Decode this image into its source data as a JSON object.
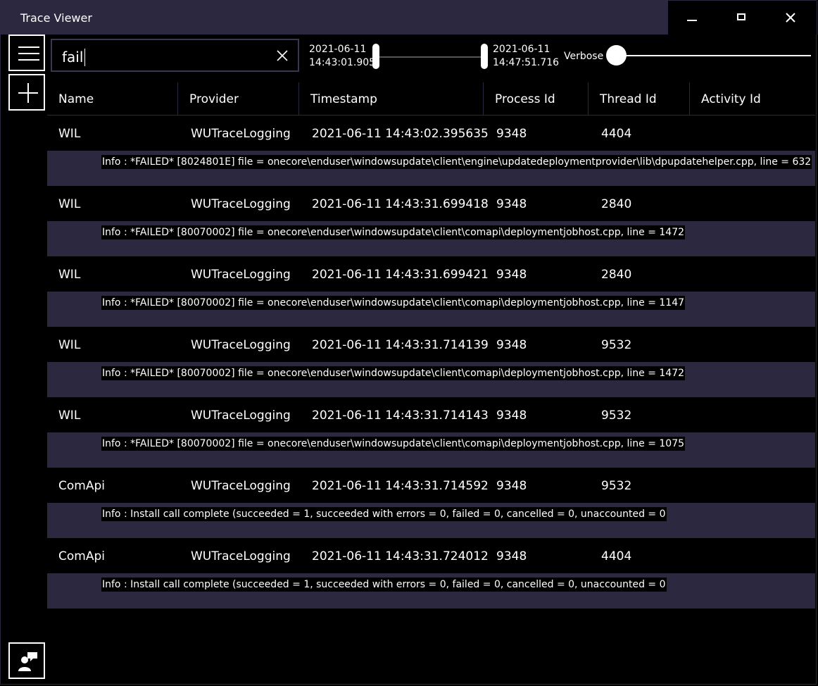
{
  "window": {
    "title": "Trace Viewer"
  },
  "search": {
    "value": "fail"
  },
  "time_range": {
    "start_date": "2021-06-11",
    "start_time": "14:43:01.905",
    "end_date": "2021-06-11",
    "end_time": "14:47:51.716"
  },
  "verbosity": {
    "label": "Verbose"
  },
  "table": {
    "columns": [
      "Name",
      "Provider",
      "Timestamp",
      "Process Id",
      "Thread Id",
      "Activity Id"
    ],
    "rows": [
      {
        "name": "WIL",
        "provider": "WUTraceLogging",
        "timestamp": "2021-06-11 14:43:02.395635",
        "process_id": "9348",
        "thread_id": "4404",
        "activity_id": "",
        "message": "Info : *FAILED* [8024801E] file = onecore\\enduser\\windowsupdate\\client\\engine\\updatedeploymentprovider\\lib\\dpupdatehelper.cpp, line = 632"
      },
      {
        "name": "WIL",
        "provider": "WUTraceLogging",
        "timestamp": "2021-06-11 14:43:31.699418",
        "process_id": "9348",
        "thread_id": "2840",
        "activity_id": "",
        "message": "Info : *FAILED* [80070002] file = onecore\\enduser\\windowsupdate\\client\\comapi\\deploymentjobhost.cpp, line = 1472"
      },
      {
        "name": "WIL",
        "provider": "WUTraceLogging",
        "timestamp": "2021-06-11 14:43:31.699421",
        "process_id": "9348",
        "thread_id": "2840",
        "activity_id": "",
        "message": "Info : *FAILED* [80070002] file = onecore\\enduser\\windowsupdate\\client\\comapi\\deploymentjobhost.cpp, line = 1147"
      },
      {
        "name": "WIL",
        "provider": "WUTraceLogging",
        "timestamp": "2021-06-11 14:43:31.714139",
        "process_id": "9348",
        "thread_id": "9532",
        "activity_id": "",
        "message": "Info : *FAILED* [80070002] file = onecore\\enduser\\windowsupdate\\client\\comapi\\deploymentjobhost.cpp, line = 1472"
      },
      {
        "name": "WIL",
        "provider": "WUTraceLogging",
        "timestamp": "2021-06-11 14:43:31.714143",
        "process_id": "9348",
        "thread_id": "9532",
        "activity_id": "",
        "message": "Info : *FAILED* [80070002] file = onecore\\enduser\\windowsupdate\\client\\comapi\\deploymentjobhost.cpp, line = 1075"
      },
      {
        "name": "ComApi",
        "provider": "WUTraceLogging",
        "timestamp": "2021-06-11 14:43:31.714592",
        "process_id": "9348",
        "thread_id": "9532",
        "activity_id": "",
        "message": "Info : Install call complete (succeeded = 1, succeeded with errors = 0, failed = 0, cancelled = 0, unaccounted = 0"
      },
      {
        "name": "ComApi",
        "provider": "WUTraceLogging",
        "timestamp": "2021-06-11 14:43:31.724012",
        "process_id": "9348",
        "thread_id": "4404",
        "activity_id": "",
        "message": "Info : Install call complete (succeeded = 1, succeeded with errors = 0, failed = 0, cancelled = 0, unaccounted = 0"
      }
    ]
  },
  "icons": {
    "menu": "hamburger-menu-icon",
    "add": "plus-icon",
    "feedback": "feedback-icon",
    "clear": "close-icon"
  },
  "colors": {
    "background": "#000000",
    "titlebar": "#2b2840",
    "detail_row": "#2b2840",
    "text": "#ffffff"
  }
}
